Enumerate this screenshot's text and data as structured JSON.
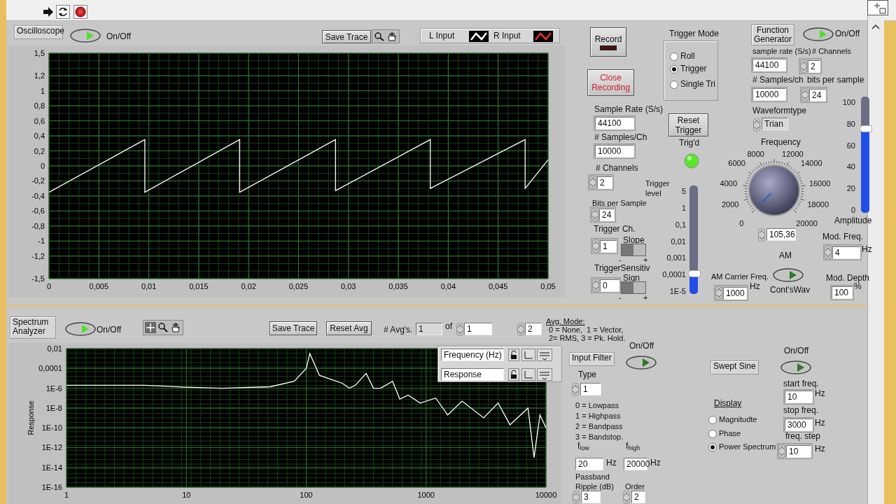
{
  "oscilloscope": {
    "title": "Oscilloscope",
    "power": {
      "label": "On/Off",
      "on": true
    },
    "save_trace": "Save Trace",
    "chart_data": {
      "type": "line",
      "grid": true,
      "x": [
        0,
        0.0096,
        0.0096,
        0.0191,
        0.0191,
        0.0287,
        0.0287,
        0.0382,
        0.0382,
        0.0477,
        0.0477,
        0.05
      ],
      "xlim": [
        0,
        0.05
      ],
      "ylim": [
        -1.5,
        1.5
      ],
      "xticks": [
        {
          "value": 0,
          "label": "0"
        },
        {
          "value": 0.005,
          "label": "0,005"
        },
        {
          "value": 0.01,
          "label": "0,01"
        },
        {
          "value": 0.015,
          "label": "0,015"
        },
        {
          "value": 0.02,
          "label": "0,02"
        },
        {
          "value": 0.025,
          "label": "0,025"
        },
        {
          "value": 0.03,
          "label": "0,03"
        },
        {
          "value": 0.035,
          "label": "0,035"
        },
        {
          "value": 0.04,
          "label": "0,04"
        },
        {
          "value": 0.045,
          "label": "0,045"
        },
        {
          "value": 0.05,
          "label": "0,05"
        }
      ],
      "yticks": [
        {
          "value": 1.5,
          "label": "1,5"
        },
        {
          "value": 1.2,
          "label": "1,2"
        },
        {
          "value": 1,
          "label": "1"
        },
        {
          "value": 0.8,
          "label": "0,8"
        },
        {
          "value": 0.6,
          "label": "0,6"
        },
        {
          "value": 0.4,
          "label": "0,4"
        },
        {
          "value": 0.2,
          "label": "0,2"
        },
        {
          "value": 0,
          "label": "0"
        },
        {
          "value": -0.2,
          "label": "-0,2"
        },
        {
          "value": -0.4,
          "label": "-0,4"
        },
        {
          "value": -0.6,
          "label": "-0,6"
        },
        {
          "value": -0.8,
          "label": "-0,8"
        },
        {
          "value": -1,
          "label": "-1"
        },
        {
          "value": -1.2,
          "label": "-1,2"
        },
        {
          "value": -1.5,
          "label": "-1,5"
        }
      ],
      "series": [
        {
          "name": "L Input",
          "color": "#ffffff",
          "values": [
            -0.35,
            0.35,
            -0.35,
            0.35,
            -0.35,
            0.35,
            -0.33,
            0.35,
            -0.3,
            0.35,
            -0.3,
            0.08
          ]
        },
        {
          "name": "R Input",
          "color": "#e03030",
          "values": [
            null,
            null,
            null,
            null,
            null,
            null,
            null,
            null,
            null,
            null,
            null,
            null
          ]
        }
      ]
    }
  },
  "recorder": {
    "record": {
      "label": "Record",
      "on": false
    },
    "close": "Close Recording"
  },
  "trigger_mode": {
    "title": "Trigger Mode",
    "options": [
      {
        "label": "Roll",
        "selected": false
      },
      {
        "label": "Trigger",
        "selected": true
      },
      {
        "label": "Single Tri",
        "selected": false
      }
    ]
  },
  "acquisition": {
    "numerics": [
      {
        "label": "Sample Rate (S/s)",
        "value": "44100",
        "spinner": false
      },
      {
        "label": "# Samples/Ch",
        "value": "10000",
        "spinner": false
      },
      {
        "label": "# Channels",
        "value": "2",
        "spinner": true
      },
      {
        "label": "Bits per Sample",
        "value": "24",
        "spinner": true
      },
      {
        "label": "Trigger Ch.",
        "value": "1",
        "spinner": true
      },
      {
        "label": "TriggerSensitiv",
        "value": "0",
        "spinner": true
      }
    ],
    "switches": [
      {
        "label": "Slope",
        "on": false,
        "minus": "-",
        "plus": "+"
      },
      {
        "label": "Sign",
        "on": false,
        "minus": "-",
        "plus": "+"
      }
    ]
  },
  "trigger": {
    "reset": "Reset Trigger",
    "trigd": {
      "label": "Trig'd",
      "on": true
    },
    "level": {
      "label": "Trigger level",
      "level": 0.19,
      "ticks": [
        "5",
        "1",
        "0,1",
        "0,01",
        "0,001",
        "0,0001",
        "1E-5"
      ]
    }
  },
  "function_generator": {
    "title": "Function Generator",
    "power": {
      "label": "On/Off",
      "on": true
    },
    "numerics": [
      {
        "label": "sample rate (S/s)",
        "value": "44100",
        "spinner": false
      },
      {
        "label": "# Channels",
        "value": "2",
        "spinner": true
      },
      {
        "label": "# Samples/ch",
        "value": "10000",
        "spinner": false
      },
      {
        "label": "bits per sample",
        "value": "24",
        "spinner": true
      },
      {
        "label": "Mod. Freq.",
        "value": "4",
        "spinner": true,
        "unit": "Hz"
      },
      {
        "label": "AM Carrier Freq.",
        "value": "1000",
        "spinner": true,
        "unit": "Hz"
      },
      {
        "label": "Mod. Depth",
        "value": "100",
        "spinner": false,
        "unit": "%"
      }
    ],
    "waveform": {
      "label": "Waveformtype",
      "value": "Trian"
    },
    "frequency": {
      "label": "Frequency",
      "value": "105,36",
      "ticks": [
        "0",
        "2000",
        "4000",
        "6000",
        "8000",
        "12000",
        "14000",
        "16000",
        "18000",
        "20000"
      ]
    },
    "amplitude": {
      "label": "Amplitude",
      "level": 0.72,
      "ticks": [
        "100",
        "80",
        "60",
        "40",
        "20",
        "0"
      ]
    },
    "am": {
      "label": "AM",
      "on": false,
      "caption": "Cont'sWav"
    }
  },
  "spectrum": {
    "title": "Spectrum Analyzer",
    "power": {
      "label": "On/Off",
      "on": true
    },
    "save_trace": "Save Trace",
    "reset_avg": "Reset Avg",
    "avgs": {
      "label": "# Avg's.",
      "value": "1",
      "of": "of",
      "total": "1"
    },
    "avg_mode": {
      "value": "2",
      "heading": "Avg. Mode:",
      "lines": [
        "0 = None,  1 = Vector,",
        "2= RMS, 3 = Pk. Hold."
      ]
    },
    "cursor_legend": [
      "Frequency (Hz)",
      "Response"
    ],
    "graph": {
      "y_title": "Response",
      "x_labels": [
        "1",
        "10",
        "100",
        "1000",
        "10000"
      ],
      "y_labels": [
        "0,01",
        "0,0001",
        "1E-6",
        "1E-8",
        "1E-10",
        "1E-12",
        "1E-14",
        "1E-16"
      ]
    }
  },
  "input_filter": {
    "title": "Input Filter",
    "power": {
      "label": "On/Off",
      "on": false
    },
    "type": {
      "label": "Type",
      "value": "1"
    },
    "legend": [
      "0 = Lowpass",
      "1 = Highpass",
      "2 = Bandpass",
      "3 = Bandstop."
    ],
    "f_low": {
      "label": "f$_{low}$",
      "value": "20",
      "unit": "Hz"
    },
    "f_high": {
      "label": "f$_{high}$",
      "value": "20000",
      "unit": "Hz"
    },
    "ripple": {
      "label": "Passband Ripple (dB)",
      "value": "3"
    },
    "order": {
      "label": "Order",
      "value": "2"
    }
  },
  "swept_sine": {
    "title": "Swept Sine",
    "power": {
      "label": "On/Off",
      "on": false
    },
    "display": {
      "title": "Display",
      "options": [
        {
          "label": "Magnitudte",
          "selected": false
        },
        {
          "label": "Phase",
          "selected": false
        },
        {
          "label": "Power  Spectrum",
          "selected": true
        }
      ]
    },
    "numerics": [
      {
        "label": "start freq.",
        "value": "10",
        "spinner": false,
        "unit": "Hz"
      },
      {
        "label": "stop freq.",
        "value": "3000",
        "spinner": false,
        "unit": "Hz"
      },
      {
        "label": "freq. step",
        "value": "10",
        "spinner": true,
        "unit": "Hz"
      }
    ]
  }
}
